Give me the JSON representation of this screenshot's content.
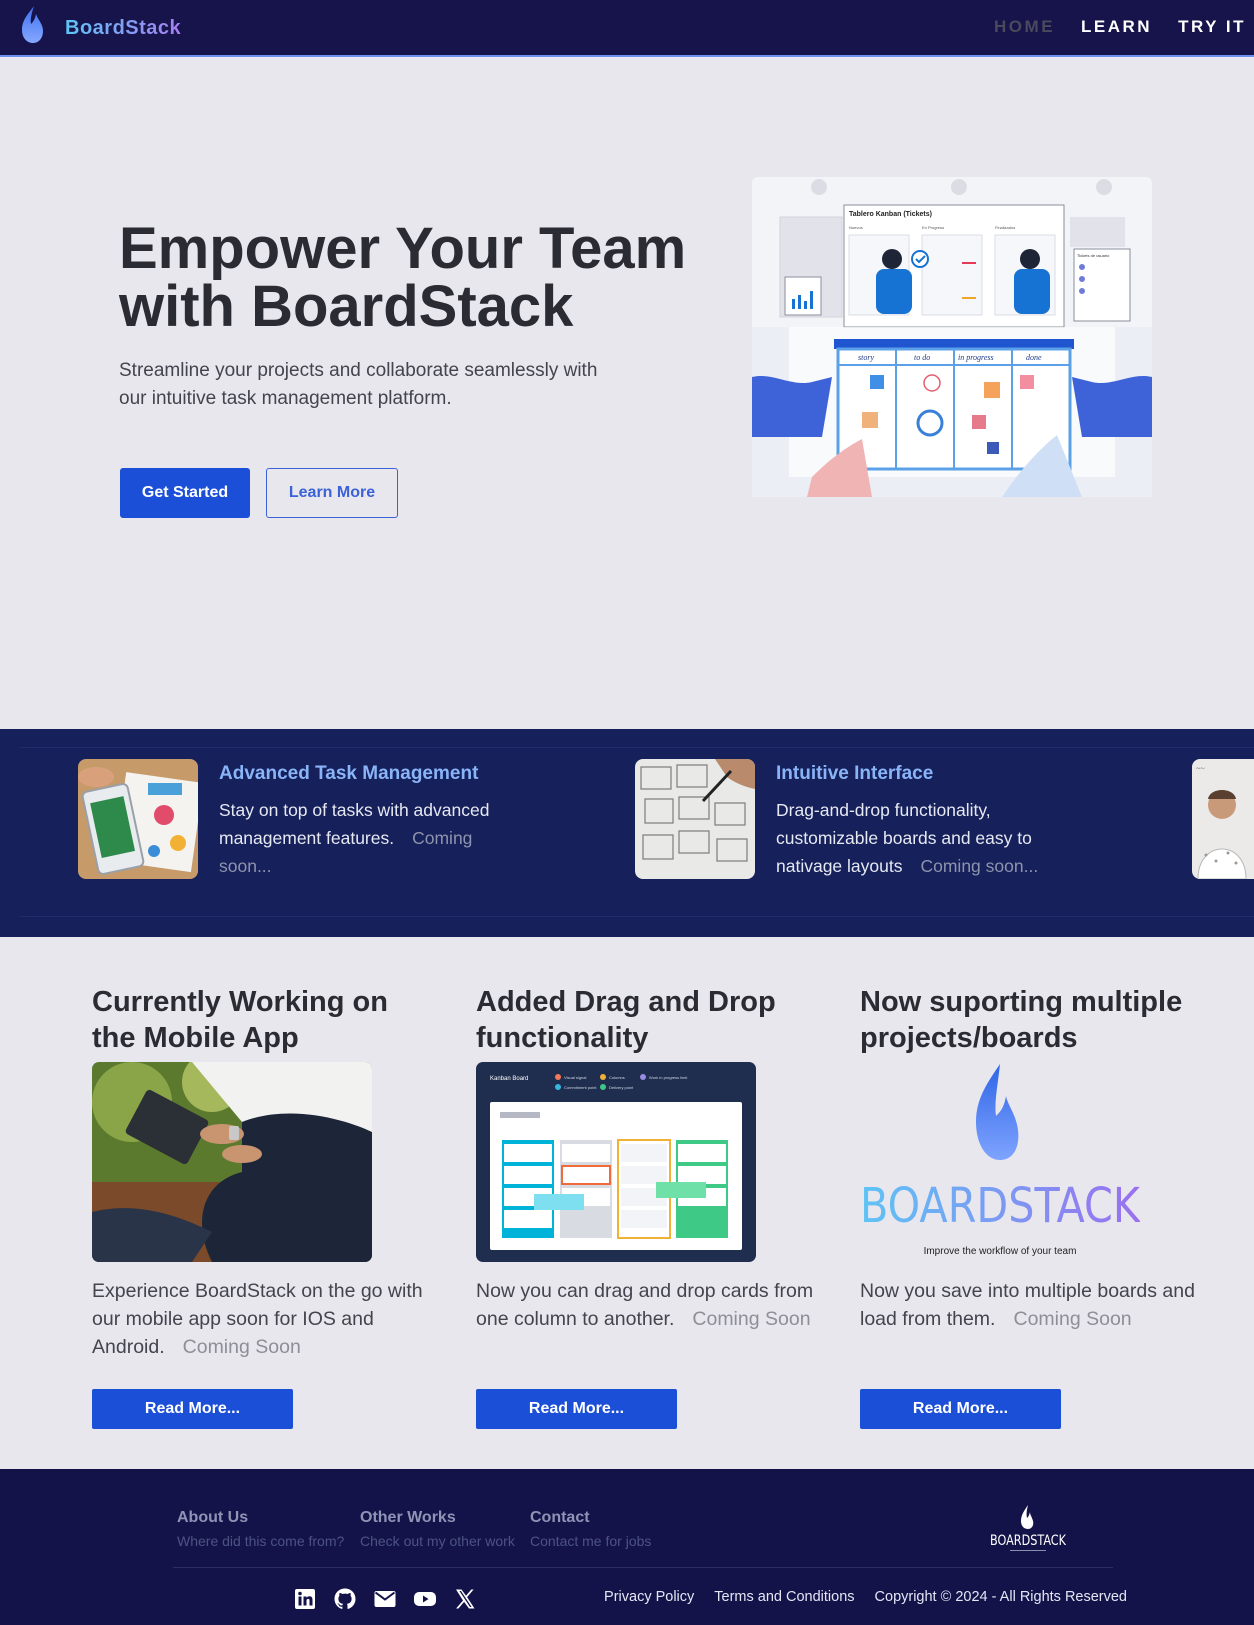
{
  "nav": {
    "brand": "BoardStack",
    "links": [
      "HOME",
      "LEARN",
      "TRY IT"
    ]
  },
  "hero": {
    "title": "Empower Your Team with BoardStack",
    "subtitle": "Streamline your projects and collaborate seamlessly with our intuitive task management platform.",
    "primary_button": "Get Started",
    "secondary_button": "Learn More",
    "illustration": {
      "board_title": "Tablero Kanban (Tickets)",
      "columns": [
        "Nuevos",
        "En Progreso",
        "Finalizados"
      ],
      "side_panel_title": "Tickets de usuario",
      "whiteboard_headers": [
        "story",
        "to do",
        "in progress",
        "done"
      ]
    }
  },
  "features": [
    {
      "title": "Advanced Task Management",
      "text": "Stay on top of tasks with advanced management features.",
      "status": "Coming soon...",
      "image_icon": "tablet-analytics-photo"
    },
    {
      "title": "Intuitive Interface",
      "text": "Drag-and-drop functionality, customizable boards and easy to nativage layouts",
      "status": "Coming soon...",
      "image_icon": "wireframe-sketch-photo"
    }
  ],
  "cards": [
    {
      "title": "Currently Working on the Mobile App",
      "text": "Experience BoardStack on the go with our mobile app soon for IOS and Android.",
      "status": "Coming Soon",
      "button": "Read More..."
    },
    {
      "title": "Added Drag and Drop functionality",
      "text": "Now you can drag and drop cards from one column to another.",
      "status": "Coming Soon",
      "button": "Read More...",
      "image": {
        "board_title": "Kanban Board",
        "legend": [
          "Visual signal",
          "Columns",
          "Work in progress limit",
          "Commitment point",
          "Delivery point"
        ]
      }
    },
    {
      "title": "Now suporting multiple projects/boards",
      "text": "Now you save into multiple boards and load from them.",
      "status": "Coming Soon",
      "button": "Read More...",
      "image": {
        "wordmark": "BOARDSTACK",
        "tagline": "Improve the workflow of your team"
      }
    }
  ],
  "footer": {
    "columns": [
      {
        "heading": "About Us",
        "sub": "Where did this come from?"
      },
      {
        "heading": "Other Works",
        "sub": "Check out my other work"
      },
      {
        "heading": "Contact",
        "sub": "Contact me for jobs"
      }
    ],
    "logo_wordmark": "BOARDSTACK",
    "socials": [
      "linkedin-icon",
      "github-icon",
      "mail-icon",
      "youtube-icon",
      "x-icon"
    ],
    "links": [
      "Privacy Policy",
      "Terms and Conditions"
    ],
    "copyright": "Copyright © 2024 - All Rights Reserved"
  },
  "colors": {
    "nav_bg": "#16144a",
    "strip_bg": "#16205a",
    "footer_bg": "#141349",
    "primary": "#1c4fd8",
    "feature_title": "#8ab4f8",
    "page_bg": "#e8e7ee"
  }
}
